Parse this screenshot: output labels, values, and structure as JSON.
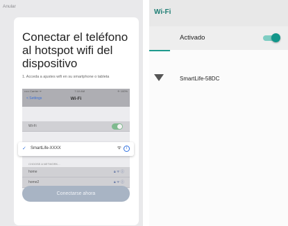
{
  "left": {
    "cancel_label": "Anular",
    "title": "Conectar el teléfono al hotspot wifi del dispositivo",
    "hint": "1. Acceda a ajustes wifi en su smartphone o tableta",
    "ios": {
      "status_left": "••••• Carrier ᯤ",
      "status_center": "7:10 AM",
      "status_right": "✈ 100%",
      "back_label": "< Settings",
      "title": "Wi-Fi",
      "wifi_row_label": "Wi-Fi",
      "selected_network": "SmartLife-XXXX",
      "choose_label": "CHOOSE A NETWORK...",
      "networks": [
        "home",
        "home2"
      ]
    },
    "connect_button": "Conectarse ahora"
  },
  "right": {
    "title": "Wi-Fi",
    "toggle_label": "Activado",
    "network_name": "SmartLife-58DC",
    "accent_color": "#1e9a8d"
  }
}
